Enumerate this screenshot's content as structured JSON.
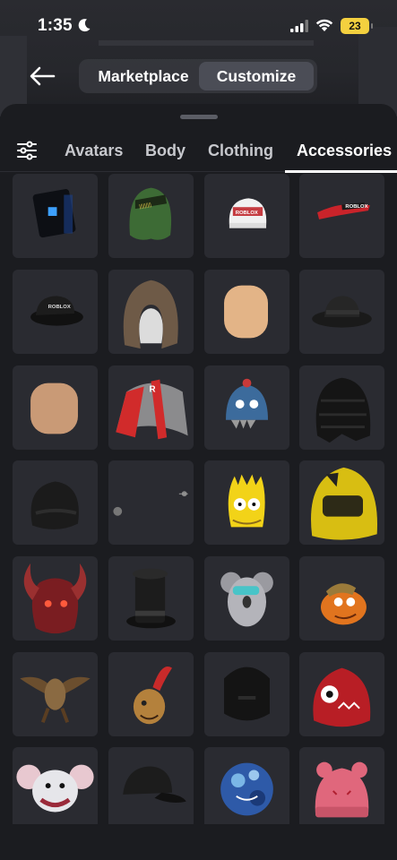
{
  "status": {
    "time": "1:35",
    "battery": "23"
  },
  "top_nav": {
    "tabs": [
      "Marketplace",
      "Customize"
    ],
    "active_tab": "Customize"
  },
  "categories": {
    "tabs": [
      "Avatars",
      "Body",
      "Clothing",
      "Accessories"
    ],
    "active": "Accessories"
  },
  "items": [
    {
      "name": "blue-light-cube",
      "text": ""
    },
    {
      "name": "green-hood",
      "text": ""
    },
    {
      "name": "roblox-white-cap",
      "text": "ROBLOX"
    },
    {
      "name": "red-visor",
      "text": "ROBLOX"
    },
    {
      "name": "black-cap",
      "text": "ROBLOX"
    },
    {
      "name": "fur-hood",
      "text": ""
    },
    {
      "name": "tan-head",
      "text": ""
    },
    {
      "name": "black-fedora",
      "text": ""
    },
    {
      "name": "tan-head-2",
      "text": ""
    },
    {
      "name": "red-gray-cap",
      "text": "R"
    },
    {
      "name": "blue-monster-beanie",
      "text": ""
    },
    {
      "name": "black-puffer-hair",
      "text": ""
    },
    {
      "name": "black-beanie",
      "text": ""
    },
    {
      "name": "small-items",
      "text": ""
    },
    {
      "name": "bart-head",
      "text": ""
    },
    {
      "name": "yellow-helmet",
      "text": ""
    },
    {
      "name": "demon-mask",
      "text": ""
    },
    {
      "name": "black-top-hat",
      "text": ""
    },
    {
      "name": "koala-glasses",
      "text": ""
    },
    {
      "name": "fishstick-head",
      "text": ""
    },
    {
      "name": "monkey-wings",
      "text": ""
    },
    {
      "name": "chicken-head",
      "text": ""
    },
    {
      "name": "black-mask",
      "text": ""
    },
    {
      "name": "red-kraken-head",
      "text": ""
    },
    {
      "name": "mouse-face",
      "text": ""
    },
    {
      "name": "black-cap-2",
      "text": ""
    },
    {
      "name": "camo-ball",
      "text": ""
    },
    {
      "name": "pink-bear-beanie",
      "text": ""
    }
  ],
  "colors": {
    "background": "#1b1c20",
    "tile": "#2a2b31",
    "accent_battery": "#f4d03f"
  }
}
